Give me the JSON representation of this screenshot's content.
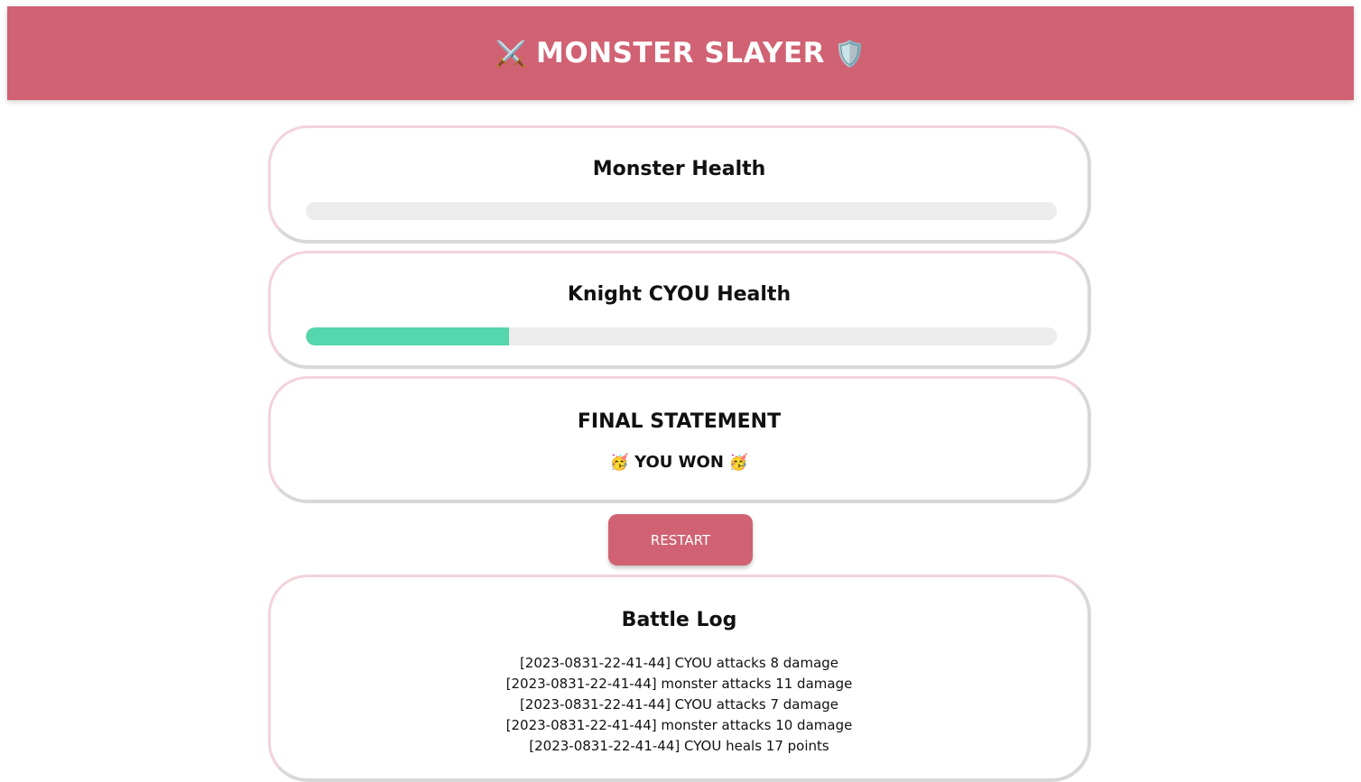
{
  "header": {
    "title": "MONSTER SLAYER",
    "left_emoji": "⚔️",
    "right_emoji": "🛡️",
    "background_color": "#d06273"
  },
  "monster": {
    "title": "Monster Health",
    "health_percent": 0
  },
  "player": {
    "title": "Knight CYOU Health",
    "health_percent": 27,
    "bar_color": "#55d6ad"
  },
  "final": {
    "title": "FINAL STATEMENT",
    "result": "YOU WON",
    "emoji": "🥳"
  },
  "restart_button": {
    "label": "RESTART"
  },
  "battle_log": {
    "title": "Battle Log",
    "entries": [
      "[2023-0831-22-41-44] CYOU attacks 8 damage",
      "[2023-0831-22-41-44] monster attacks 11 damage",
      "[2023-0831-22-41-44] CYOU attacks 7 damage",
      "[2023-0831-22-41-44] monster attacks 10 damage",
      "[2023-0831-22-41-44] CYOU heals 17 points"
    ]
  }
}
